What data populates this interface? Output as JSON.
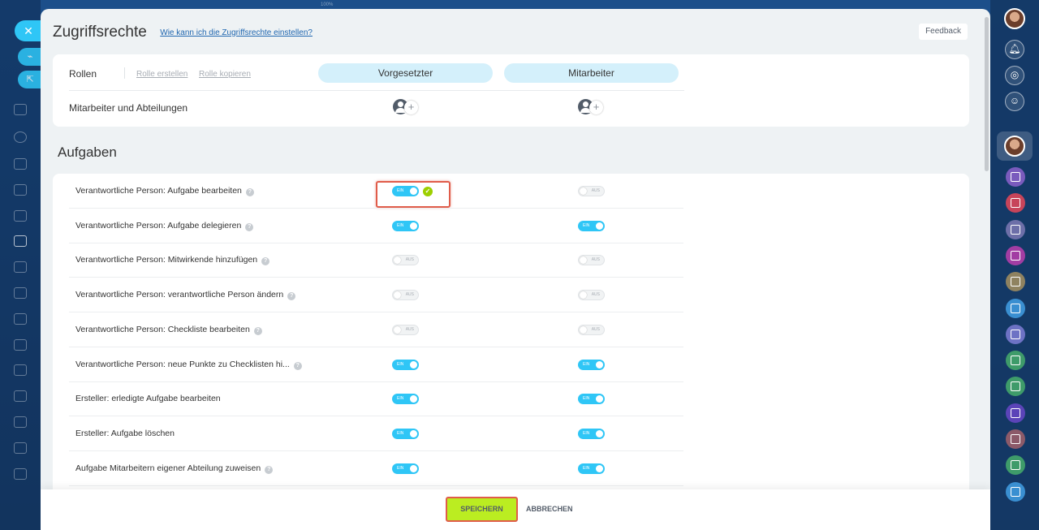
{
  "browser": {
    "zoom": "100%"
  },
  "header": {
    "title": "Zugriffsrechte",
    "help_link": "Wie kann ich die Zugriffsrechte einstellen?",
    "feedback": "Feedback"
  },
  "roles": {
    "label": "Rollen",
    "create": "Rolle erstellen",
    "copy": "Rolle kopieren",
    "columns": [
      "Vorgesetzter",
      "Mitarbeiter"
    ],
    "members_label": "Mitarbeiter und Abteilungen"
  },
  "section": {
    "title": "Aufgaben"
  },
  "toggle_text": {
    "on": "EIN",
    "off": "AUS"
  },
  "permissions": [
    {
      "label": "Verantwortliche Person: Aufgabe bearbeiten",
      "help": true,
      "values": [
        "EIN",
        "AUS"
      ],
      "saved": true
    },
    {
      "label": "Verantwortliche Person: Aufgabe delegieren",
      "help": true,
      "values": [
        "EIN",
        "EIN"
      ]
    },
    {
      "label": "Verantwortliche Person: Mitwirkende hinzufügen",
      "help": true,
      "values": [
        "AUS",
        "AUS"
      ]
    },
    {
      "label": "Verantwortliche Person: verantwortliche Person ändern",
      "help": true,
      "values": [
        "AUS",
        "AUS"
      ]
    },
    {
      "label": "Verantwortliche Person: Checkliste bearbeiten",
      "help": true,
      "values": [
        "AUS",
        "AUS"
      ]
    },
    {
      "label": "Verantwortliche Person: neue Punkte zu Checklisten hi...",
      "help": true,
      "values": [
        "EIN",
        "EIN"
      ]
    },
    {
      "label": "Ersteller: erledigte Aufgabe bearbeiten",
      "help": false,
      "values": [
        "EIN",
        "EIN"
      ]
    },
    {
      "label": "Ersteller: Aufgabe löschen",
      "help": false,
      "values": [
        "EIN",
        "EIN"
      ]
    },
    {
      "label": "Aufgabe Mitarbeitern eigener Abteilung zuweisen",
      "help": true,
      "values": [
        "EIN",
        "EIN"
      ]
    }
  ],
  "footer": {
    "save": "SPEICHERN",
    "cancel": "ABBRECHEN"
  },
  "icons": {
    "close": "close-icon",
    "link": "link-icon",
    "open": "open-new-icon",
    "bell": "bell-icon",
    "fingerprint": "fingerprint-icon",
    "chat": "chat-icon",
    "task": "task-icon"
  },
  "colors": {
    "accent": "#2fc6f6",
    "save": "#bbed21",
    "highlight": "#e05c4a",
    "check": "#9dcf00",
    "role_pill": "#d4f0fb"
  },
  "right_bar_tasks": [
    "#7a5bbd",
    "#c7445a",
    "#6d6fa8",
    "#a23da3",
    "#8f8260",
    "#3a8fd1",
    "#6d72c4",
    "#3e9b6a",
    "#3e9b6a",
    "#5b44b8",
    "#8c5a69",
    "#3e9b6a",
    "#3a8fd1"
  ]
}
